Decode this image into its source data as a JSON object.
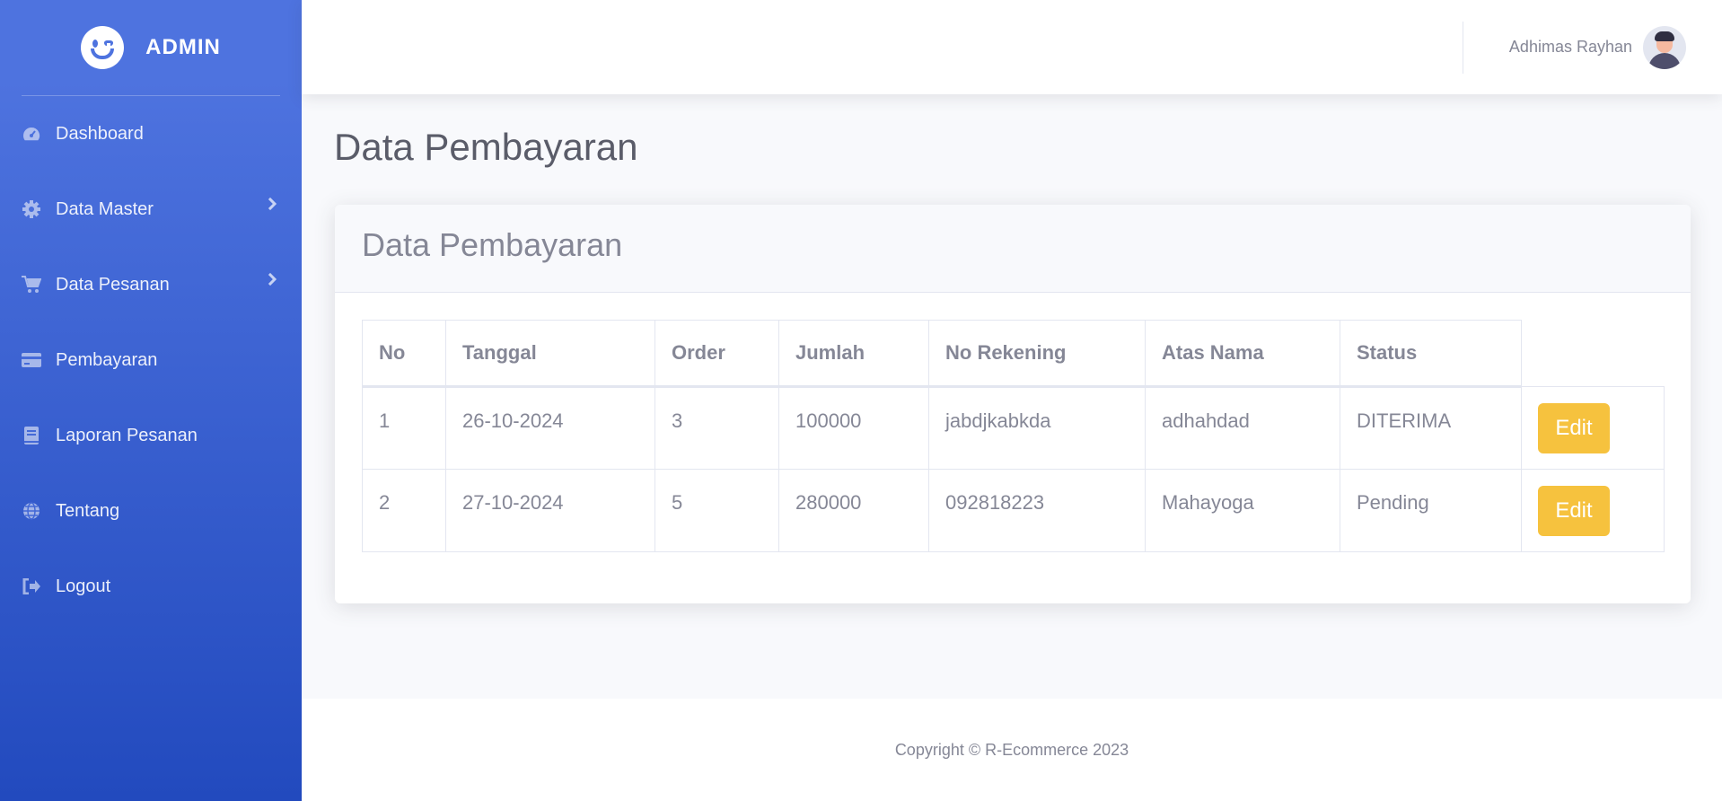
{
  "sidebar": {
    "brand": "ADMIN",
    "items": [
      {
        "label": "Dashboard",
        "icon": "tachometer-icon"
      },
      {
        "label": "Data Master",
        "icon": "gear-icon"
      },
      {
        "label": "Data Pesanan",
        "icon": "cart-icon"
      },
      {
        "label": "Pembayaran",
        "icon": "credit-card-icon"
      },
      {
        "label": "Laporan Pesanan",
        "icon": "book-icon"
      },
      {
        "label": "Tentang",
        "icon": "globe-icon"
      },
      {
        "label": "Logout",
        "icon": "sign-out-icon"
      }
    ]
  },
  "topbar": {
    "user_name": "Adhimas Rayhan"
  },
  "main": {
    "page_title": "Data Pembayaran",
    "card_title": "Data Pembayaran",
    "table": {
      "headers": [
        "No",
        "Tanggal",
        "Order",
        "Jumlah",
        "No Rekening",
        "Atas Nama",
        "Status"
      ],
      "rows": [
        {
          "no": "1",
          "tanggal": "26-10-2024",
          "order": "3",
          "jumlah": "100000",
          "no_rekening": "jabdjkabkda",
          "atas_nama": "adhahdad",
          "status": "DITERIMA",
          "action": "Edit"
        },
        {
          "no": "2",
          "tanggal": "27-10-2024",
          "order": "5",
          "jumlah": "280000",
          "no_rekening": "092818223",
          "atas_nama": "Mahayoga",
          "status": "Pending",
          "action": "Edit"
        }
      ]
    }
  },
  "footer": {
    "copyright": "Copyright © R-Ecommerce 2023"
  },
  "colors": {
    "sidebar_top": "#4e73df",
    "sidebar_bottom": "#224abe",
    "edit_button": "#f6c23e",
    "text_gray": "#858796"
  }
}
